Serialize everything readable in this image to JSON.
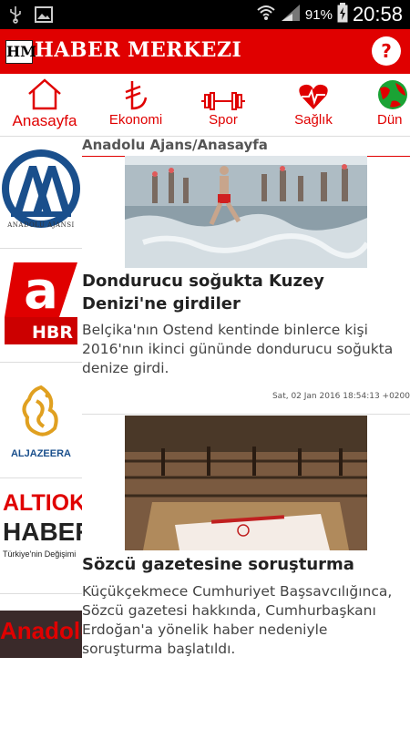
{
  "statusbar": {
    "battery_percent": "91%",
    "time": "20:58"
  },
  "app": {
    "logo_text": "HM",
    "title": "HABER MERKEZI",
    "help_label": "?"
  },
  "tabs": [
    {
      "label": "Anasayfa",
      "icon": "home-icon"
    },
    {
      "label": "Ekonomi",
      "icon": "lira-icon"
    },
    {
      "label": "Spor",
      "icon": "dumbbell-icon"
    },
    {
      "label": "Sağlık",
      "icon": "heart-pulse-icon"
    },
    {
      "label": "Dün",
      "icon": "globe-icon"
    }
  ],
  "sources": [
    {
      "name": "Anadolu Ajansı",
      "logo_text": "AA",
      "caption": "ANADOLU AJANSI"
    },
    {
      "name": "A Haber",
      "logo_text": "a",
      "caption": "HBR"
    },
    {
      "name": "Al Jazeera",
      "caption": "ALJAZEERA"
    },
    {
      "name": "Altıok Haber",
      "line1": "ALTIOK",
      "line2": "HABER",
      "tagline": "Türkiye'nin Değişimi"
    },
    {
      "name": "Anadolu",
      "logo_text": "Anadolu"
    }
  ],
  "feed": {
    "section_title": "Anadolu Ajans/Anasayfa",
    "articles": [
      {
        "headline": "Dondurucu soğukta Kuzey Denizi'ne girdiler",
        "summary": "Belçika'nın Ostend kentinde binlerce kişi 2016'nın ikinci gününde dondurucu soğukta denize girdi.",
        "timestamp": "Sat, 02 Jan 2016 18:54:13 +0200"
      },
      {
        "headline": "Sözcü gazetesine soruşturma",
        "summary": "Küçükçekmece Cumhuriyet Başsavcılığınca, Sözcü gazetesi hakkında, Cumhurbaşkanı Erdoğan'a yönelik haber nedeniyle soruşturma başlatıldı."
      }
    ]
  },
  "colors": {
    "brand_red": "#e00000"
  }
}
